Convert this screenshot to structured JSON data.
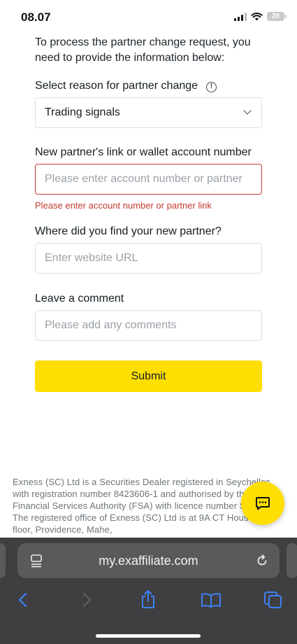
{
  "status_bar": {
    "time": "08.07",
    "battery": "28"
  },
  "form": {
    "intro": "To process the partner change request, you need to provide the information below:",
    "reason_label": "Select reason for partner change",
    "reason_value": "Trading signals",
    "partner_label": "New partner's link or wallet account number",
    "partner_placeholder": "Please enter account number or partner",
    "partner_error": "Please enter account number or partner link",
    "find_label": "Where did you find your new partner?",
    "find_placeholder": "Enter website URL",
    "comment_label": "Leave a comment",
    "comment_placeholder": "Please add any comments",
    "submit_label": "Submit"
  },
  "footer": {
    "text": "Exness (SC) Ltd is a Securities Dealer registered in Seychelles with registration number 8423606-1 and authorised by the Financial Services Authority (FSA) with licence number SD025. The registered office of Exness (SC) Ltd is at 9A CT House, 2nd floor, Providence, Mahe,"
  },
  "browser": {
    "url": "my.exaffiliate.com"
  },
  "colors": {
    "accent": "#ffde02",
    "error": "#c23a30",
    "toolbar_blue": "#3d82f6"
  }
}
